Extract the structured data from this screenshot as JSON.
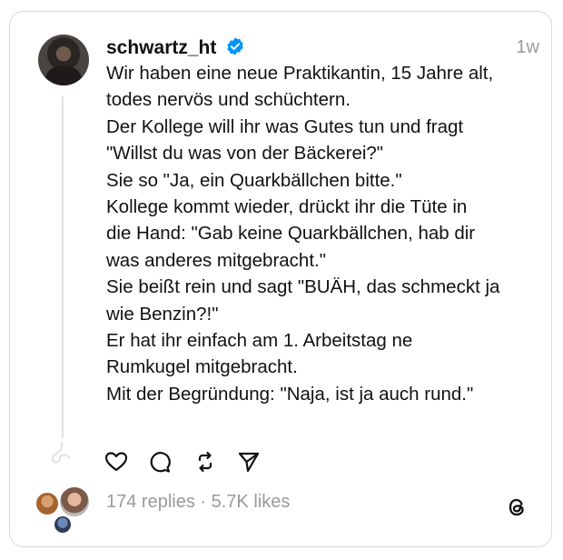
{
  "post": {
    "username": "schwartz_ht",
    "time": "1w",
    "lines": [
      "Wir haben eine neue Praktikantin, 15 Jahre alt,",
      "todes nervös und schüchtern.",
      "Der Kollege will ihr was Gutes tun und fragt",
      "\"Willst du was von der Bäckerei?\"",
      "Sie so \"Ja, ein Quarkbällchen bitte.\"",
      "Kollege kommt wieder, drückt ihr die Tüte in",
      "die Hand: \"Gab keine Quarkbällchen, hab dir",
      "was anderes mitgebracht.\"",
      "Sie beißt rein und sagt \"BUÄH, das schmeckt ja",
      "wie Benzin?!\"",
      "Er hat ihr einfach am 1. Arbeitstag ne",
      "Rumkugel mitgebracht.",
      "Mit der Begründung: \"Naja, ist ja auch rund.\""
    ],
    "stats": "174 replies · 5.7K likes"
  },
  "icons": {
    "verified": "verified-badge-icon",
    "like": "heart-icon",
    "reply": "comment-icon",
    "repost": "repost-icon",
    "share": "send-icon",
    "brand": "threads-logo-icon"
  },
  "colors": {
    "verified": "#0095f6",
    "text": "#111111",
    "muted": "#9a9a9a"
  }
}
